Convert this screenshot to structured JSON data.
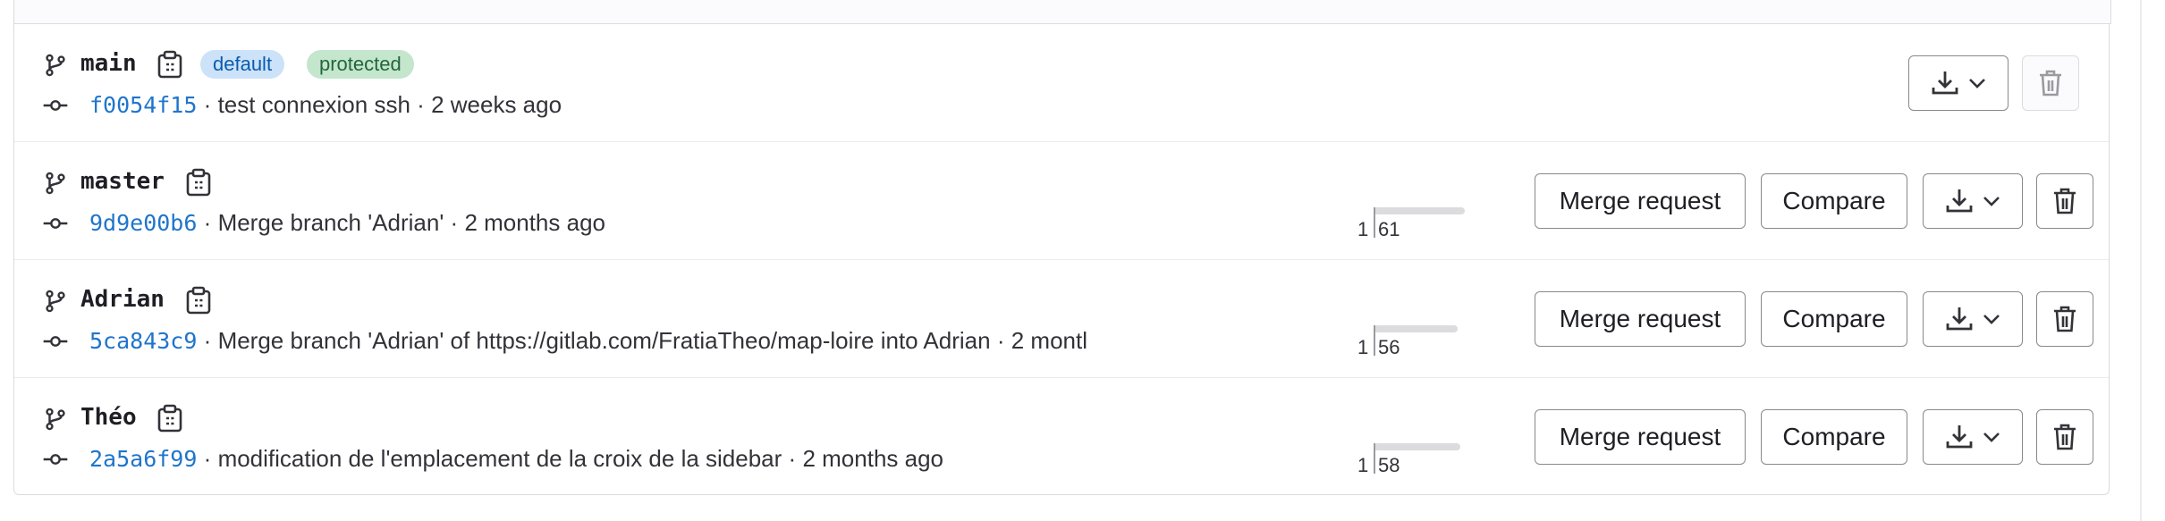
{
  "branches": [
    {
      "name": "main",
      "badges": [
        "default",
        "protected"
      ],
      "sha": "f0054f15",
      "message": "test connexion ssh",
      "age": "2 weeks ago",
      "behind": null,
      "ahead": null,
      "show_merge_request": false,
      "show_compare": false,
      "delete_disabled": true
    },
    {
      "name": "master",
      "badges": [],
      "sha": "9d9e00b6",
      "message": "Merge branch 'Adrian'",
      "age": "2 months ago",
      "behind": "1",
      "ahead": "61",
      "show_merge_request": true,
      "show_compare": true,
      "delete_disabled": false
    },
    {
      "name": "Adrian",
      "badges": [],
      "sha": "5ca843c9",
      "message": "Merge branch 'Adrian' of https://gitlab.com/FratiaTheo/map-loire into Adrian",
      "age": "2 montl",
      "behind": "1",
      "ahead": "56",
      "show_merge_request": true,
      "show_compare": true,
      "delete_disabled": false
    },
    {
      "name": "Théo",
      "badges": [],
      "sha": "2a5a6f99",
      "message": "modification de l'emplacement de la croix de la sidebar",
      "age": "2 months ago",
      "behind": "1",
      "ahead": "58",
      "show_merge_request": true,
      "show_compare": true,
      "delete_disabled": false
    }
  ],
  "labels": {
    "merge_request": "Merge request",
    "compare": "Compare",
    "separator": "·"
  },
  "icons": {
    "branch": "branch-icon",
    "commit": "commit-icon",
    "copy": "copy-to-clipboard-icon",
    "download": "download-icon",
    "chevron": "chevron-down-icon",
    "delete": "trash-icon"
  },
  "colors": {
    "sha_link": "#1f75cb",
    "badge_default_bg": "#cbe2f9",
    "badge_protected_bg": "#c3e6cd"
  }
}
